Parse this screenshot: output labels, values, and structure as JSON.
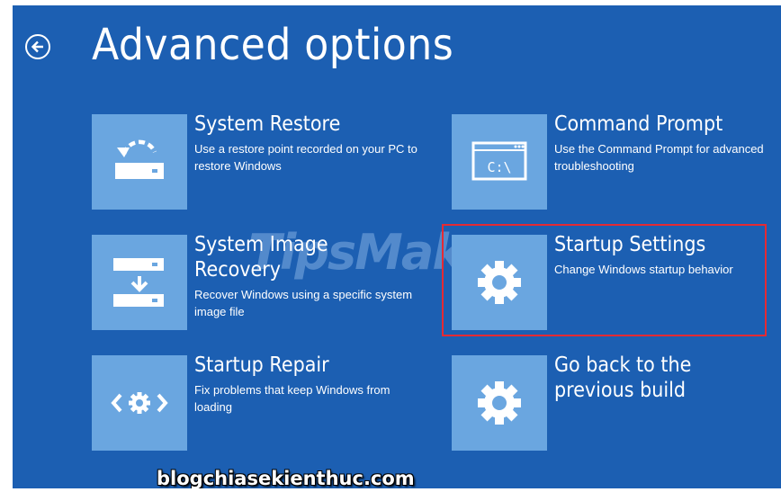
{
  "page": {
    "title": "Advanced options",
    "back_icon": "back-arrow-icon"
  },
  "options": [
    {
      "id": "system-restore",
      "title": "System Restore",
      "title_line2": "",
      "description": "Use a restore point recorded on your PC to restore Windows",
      "icon": "restore-icon"
    },
    {
      "id": "command-prompt",
      "title": "Command Prompt",
      "title_line2": "",
      "description": "Use the Command Prompt for advanced troubleshooting",
      "icon": "command-prompt-icon",
      "icon_text": "C:\\"
    },
    {
      "id": "system-image-recovery",
      "title": "System Image",
      "title_line2": "Recovery",
      "description": "Recover Windows using a specific system image file",
      "icon": "image-recovery-icon"
    },
    {
      "id": "startup-settings",
      "title": "Startup Settings",
      "title_line2": "",
      "description": "Change Windows startup behavior",
      "icon": "gear-icon",
      "highlighted": true
    },
    {
      "id": "startup-repair",
      "title": "Startup Repair",
      "title_line2": "",
      "description": "Fix problems that keep Windows from loading",
      "icon": "repair-gear-icon"
    },
    {
      "id": "go-back",
      "title": "Go back to the",
      "title_line2": "previous build",
      "description": "",
      "icon": "gear-icon"
    }
  ],
  "watermarks": {
    "center": "TipsMake",
    "footer": "blogchiasekienthuc.com"
  },
  "colors": {
    "background": "#1c5fb2",
    "tile": "#6aa6e0",
    "highlight_border": "#e52a33",
    "text": "#ffffff"
  }
}
